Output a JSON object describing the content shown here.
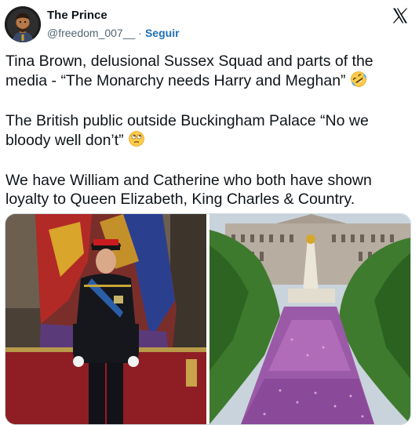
{
  "author": {
    "name": "The Prince",
    "handle": "@freedom_007__",
    "separator": "·",
    "follow_label": "Seguir"
  },
  "post": {
    "paragraphs": [
      "Tina Brown, delusional Sussex Squad and parts of the media - “The Monarchy needs Harry and Meghan”",
      "The British public outside Buckingham Palace “No we bloody well don’t”",
      "We have William and Catherine who both  have shown loyalty to Queen Elizabeth, King Charles & Country."
    ],
    "emojis": [
      "rolling-on-floor-laughing-emoji",
      "face-with-rolling-eyes-emoji"
    ]
  },
  "icons": {
    "platform_logo": "x-logo-icon"
  },
  "colors": {
    "text": "#0f1419",
    "secondary": "#536471",
    "link": "#1d70b8",
    "border": "#cfd9de"
  }
}
